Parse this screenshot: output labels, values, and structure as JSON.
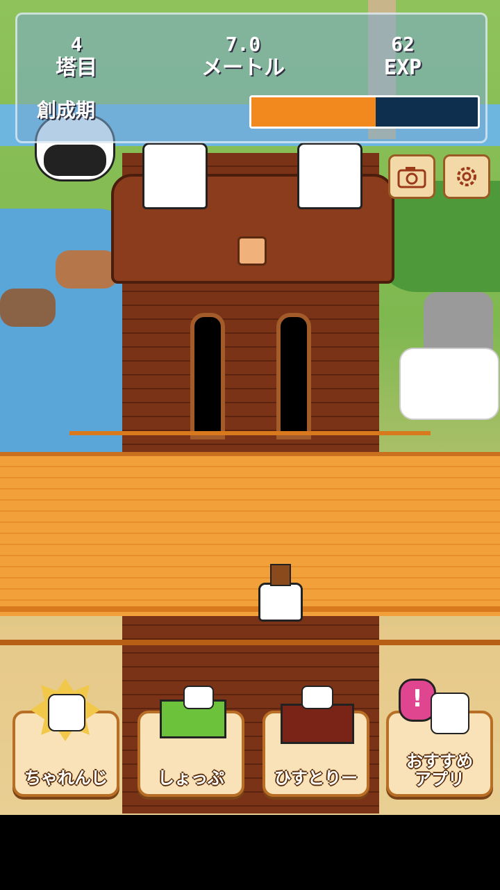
{
  "hud": {
    "floor_value": "4",
    "floor_label": "塔目",
    "height_value": "7.0",
    "height_label": "メートル",
    "exp_value": "62",
    "exp_label": "EXP",
    "era_label": "創成期",
    "progress": 0.55,
    "progress_color": "#f2891e"
  },
  "top_icons": {
    "camera": "camera-icon",
    "settings": "gear-icon"
  },
  "nav": [
    {
      "label": "ちゃれんじ",
      "icon": "sun-cat-icon"
    },
    {
      "label": "しょっぷ",
      "icon": "shopping-cart-cat-icon"
    },
    {
      "label": "ひすとりー",
      "icon": "book-cat-icon"
    },
    {
      "label": "おすすめ\nアプリ",
      "icon": "exclamation-cat-icon"
    }
  ]
}
